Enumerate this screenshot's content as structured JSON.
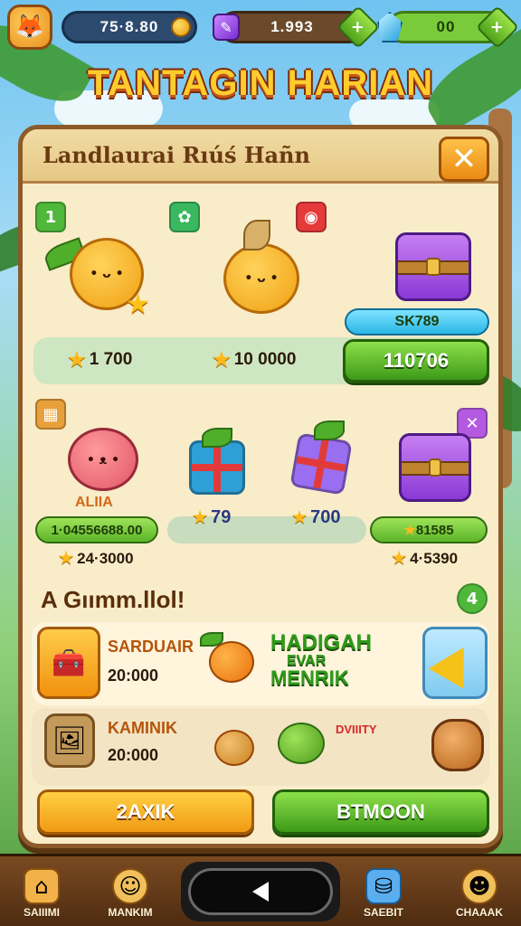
{
  "hud": {
    "currency_1": "75·8.80",
    "currency_2": "1.993",
    "currency_3": "00",
    "gem_purple_icon": "purple-gem-icon",
    "gem_blue_icon": "blue-gem-icon"
  },
  "title": "TANTAGIN HARIAN",
  "panel": {
    "header": "Landlaurai Rıúś Hañn",
    "close_symbol": "✕"
  },
  "section1": {
    "badge_1": "1",
    "badge_2": "✿",
    "badge_3": "◉",
    "reward_1": "1 700",
    "reward_2": "10 0000",
    "chest_pill": "SK789",
    "claim_button": "110706"
  },
  "section2": {
    "creature_label": "ALIIA",
    "pill_left": "1·04556688.00",
    "reward_gift": "79",
    "reward_box": "700",
    "pill_right": "81585",
    "value_left": "24·3000",
    "value_right": "4·5390",
    "close_symbol": "✕"
  },
  "section3": {
    "heading": "A Gıımm.llol!",
    "counter": "4",
    "item1_name": "SARDUAIR",
    "item1_value": "20:000",
    "hadiah_line1": "HADIGAH",
    "hadiah_line2": "EVAR",
    "hadiah_line3": "MENRIK",
    "item2_name": "KAMINIK",
    "item2_value": "20:000",
    "item3_name": "DVIIITY",
    "button_left": "2AXIK",
    "button_right": "BTMOON"
  },
  "nav": {
    "item1": "SAIIIMI",
    "item2": "MANKIM",
    "item3": "SAEBIT",
    "item4": "CHAAAK"
  },
  "colors": {
    "panel_bg": "#f8ecc9",
    "panel_border": "#8d5a2a",
    "title": "#ffcc2e",
    "green_button": "#4fa21a",
    "orange_button": "#f09a14"
  }
}
